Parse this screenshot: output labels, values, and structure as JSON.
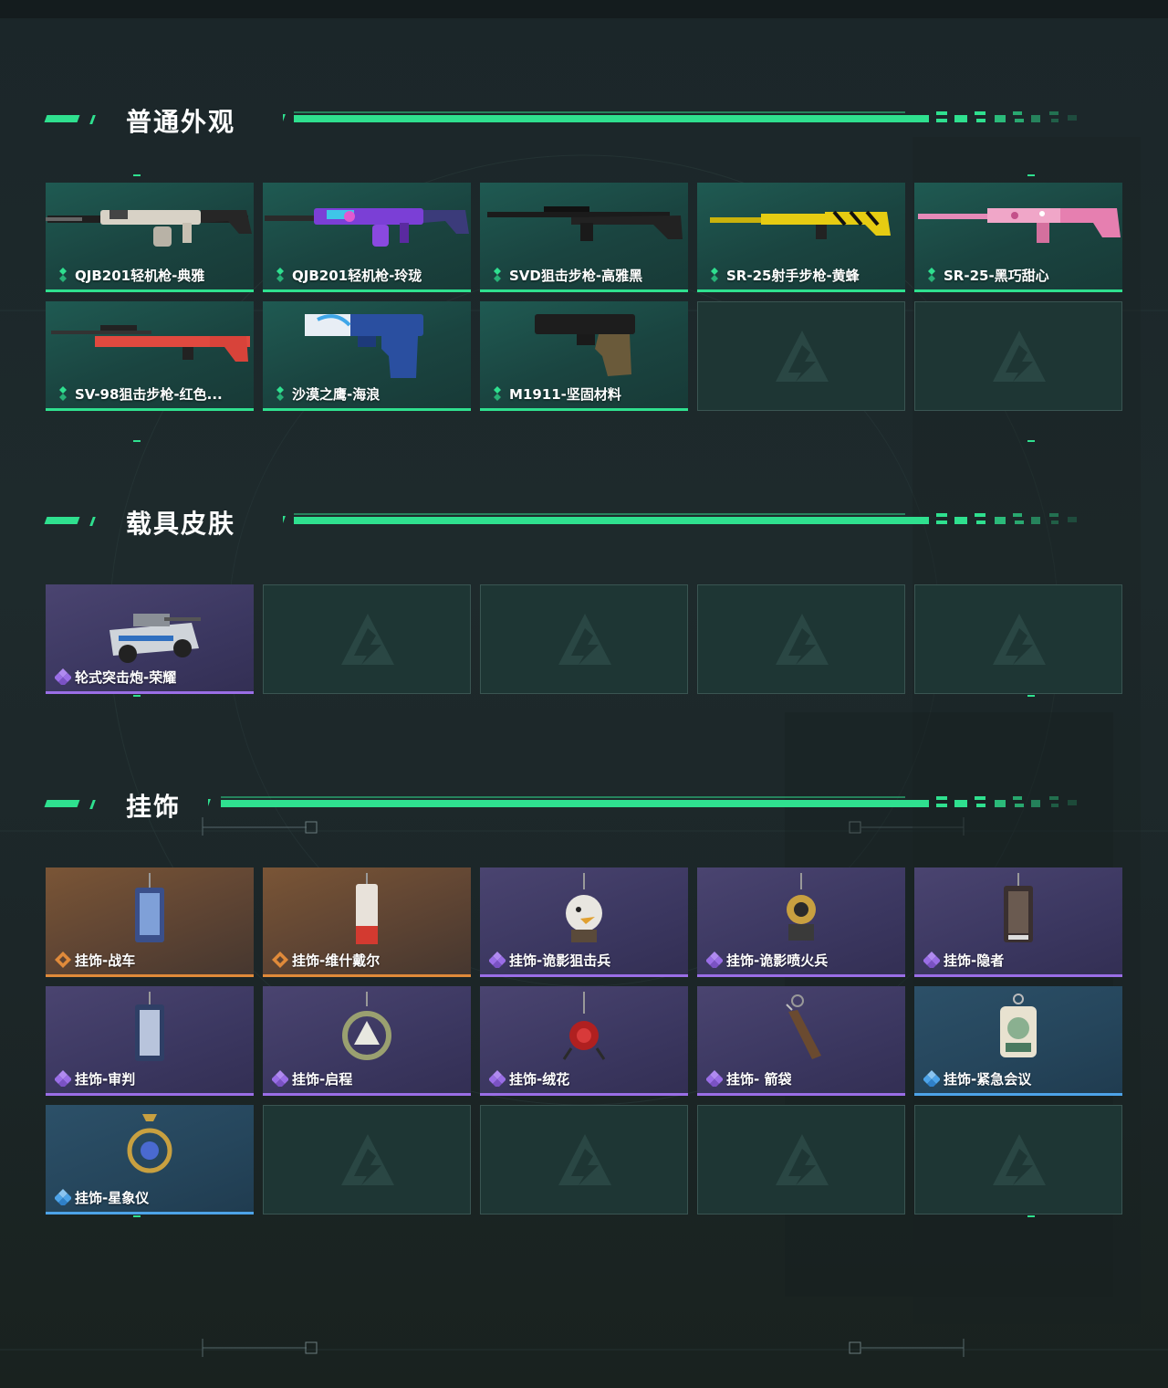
{
  "sections": [
    {
      "title": "普通外观",
      "items": [
        {
          "label": "QJB201轻机枪-典雅",
          "rarity": "green",
          "icon": "rifle-icon"
        },
        {
          "label": "QJB201轻机枪-玲珑",
          "rarity": "green",
          "icon": "rifle-icon"
        },
        {
          "label": "SVD狙击步枪-高雅黑",
          "rarity": "green",
          "icon": "sniper-icon"
        },
        {
          "label": "SR-25射手步枪-黄蜂",
          "rarity": "green",
          "icon": "rifle-icon"
        },
        {
          "label": "SR-25-黑巧甜心",
          "rarity": "green",
          "icon": "rifle-icon"
        },
        {
          "label": "SV-98狙击步枪-红色...",
          "rarity": "green",
          "icon": "sniper-icon"
        },
        {
          "label": "沙漠之鹰-海浪",
          "rarity": "green",
          "icon": "pistol-icon"
        },
        {
          "label": "M1911-坚固材料",
          "rarity": "green",
          "icon": "pistol-icon"
        }
      ]
    },
    {
      "title": "载具皮肤",
      "items": [
        {
          "label": "轮式突击炮-荣耀",
          "rarity": "purple",
          "icon": "vehicle-icon"
        }
      ]
    },
    {
      "title": "挂饰",
      "items": [
        {
          "label": "挂饰-战车",
          "rarity": "orange",
          "icon": "charm-icon"
        },
        {
          "label": "挂饰-维什戴尔",
          "rarity": "orange",
          "icon": "charm-icon"
        },
        {
          "label": "挂饰-诡影狙击兵",
          "rarity": "purple",
          "icon": "charm-icon"
        },
        {
          "label": "挂饰-诡影喷火兵",
          "rarity": "purple",
          "icon": "charm-icon"
        },
        {
          "label": "挂饰-隐者",
          "rarity": "purple",
          "icon": "charm-icon"
        },
        {
          "label": "挂饰-审判",
          "rarity": "purple",
          "icon": "charm-icon"
        },
        {
          "label": "挂饰-启程",
          "rarity": "purple",
          "icon": "charm-icon"
        },
        {
          "label": "挂饰-绒花",
          "rarity": "purple",
          "icon": "charm-icon"
        },
        {
          "label": "挂饰- 箭袋",
          "rarity": "purple",
          "icon": "charm-icon"
        },
        {
          "label": "挂饰-紧急会议",
          "rarity": "blue",
          "icon": "charm-icon"
        },
        {
          "label": "挂饰-星象仪",
          "rarity": "blue",
          "icon": "charm-icon"
        }
      ]
    }
  ],
  "colors": {
    "accent": "#2fe08f",
    "green": "#2fe08f",
    "purple": "#9a6ee6",
    "orange": "#e08a3a",
    "blue": "#4da3e8"
  }
}
